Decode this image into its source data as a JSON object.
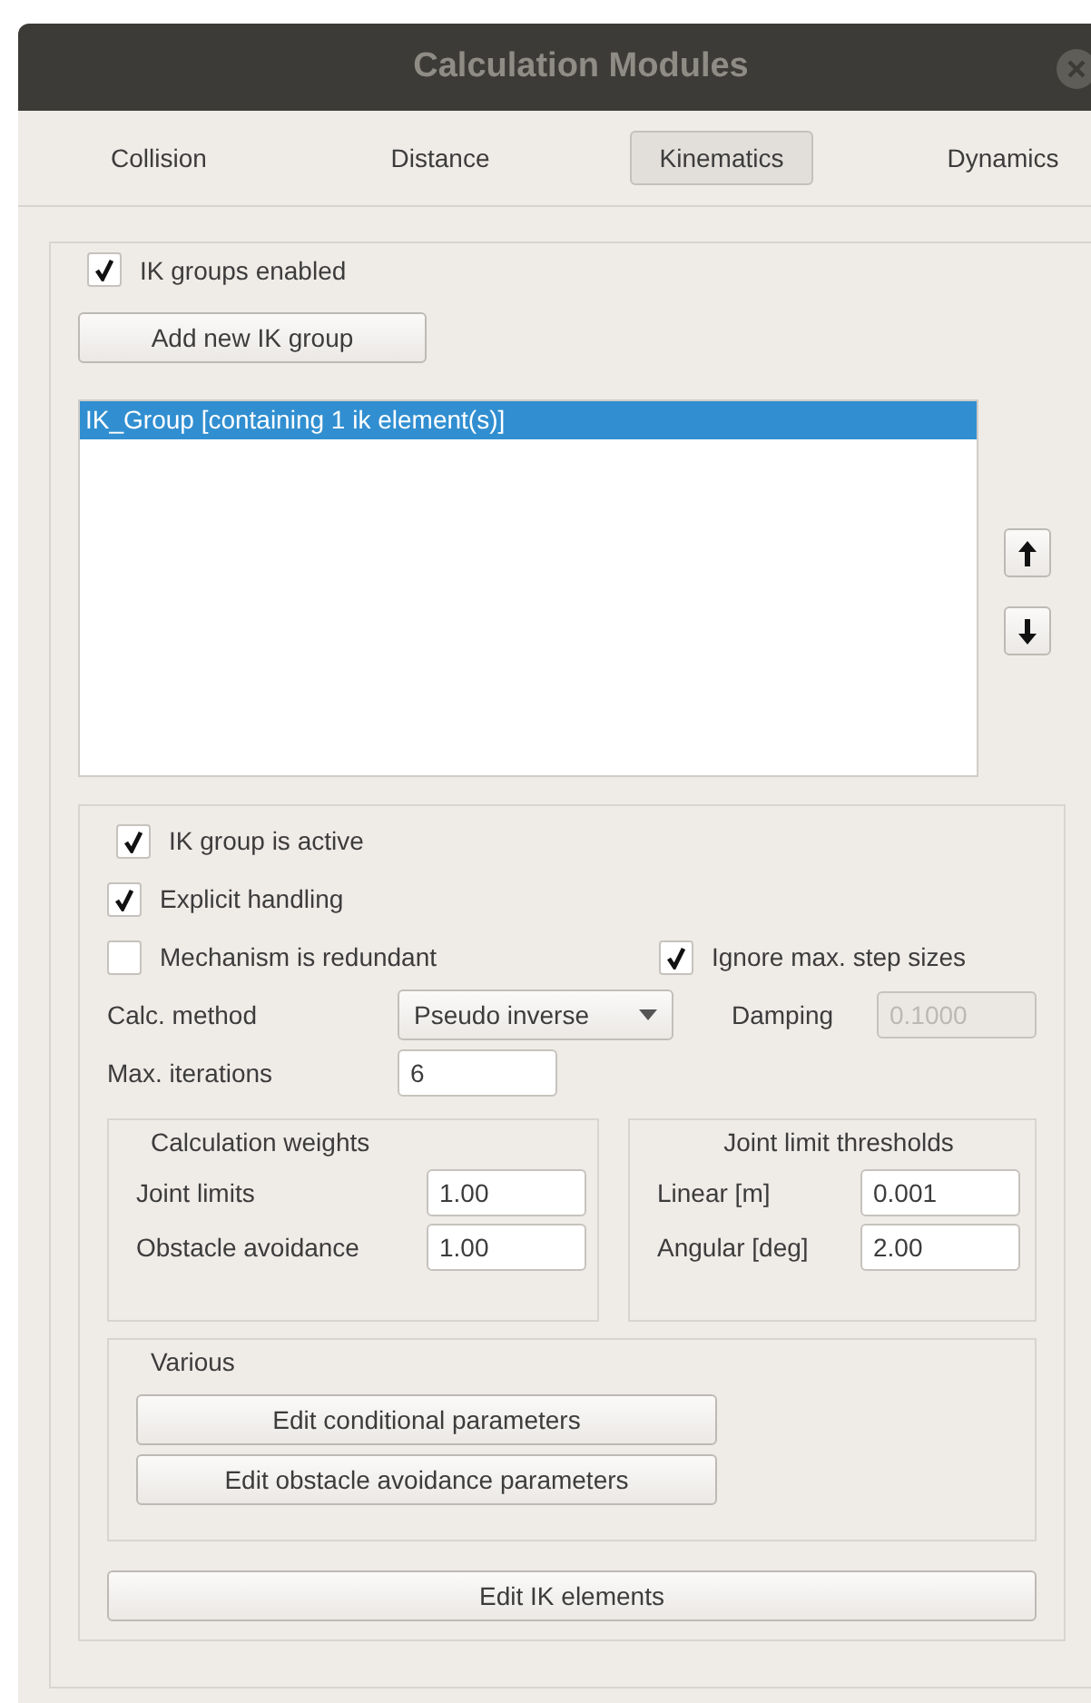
{
  "window": {
    "title": "Calculation Modules"
  },
  "tabs": [
    {
      "label": "Collision",
      "selected": false
    },
    {
      "label": "Distance",
      "selected": false
    },
    {
      "label": "Kinematics",
      "selected": true
    },
    {
      "label": "Dynamics",
      "selected": false
    }
  ],
  "groups_enabled": {
    "label": "IK groups enabled",
    "checked": true
  },
  "add_button": "Add new IK group",
  "group_list": [
    {
      "label": "IK_Group [containing 1 ik element(s)]",
      "selected": true
    }
  ],
  "group_settings": {
    "active": {
      "label": "IK group is active",
      "checked": true
    },
    "explicit_handling": {
      "label": "Explicit handling",
      "checked": true
    },
    "redundant": {
      "label": "Mechanism is redundant",
      "checked": false
    },
    "ignore_step_sizes": {
      "label": "Ignore max. step sizes",
      "checked": true
    },
    "calc_method": {
      "label": "Calc. method",
      "value": "Pseudo inverse"
    },
    "damping": {
      "label": "Damping",
      "value": "0.1000",
      "disabled": true
    },
    "max_iterations": {
      "label": "Max. iterations",
      "value": "6"
    }
  },
  "weights": {
    "title": "Calculation weights",
    "rows": [
      {
        "label": "Joint limits",
        "value": "1.00"
      },
      {
        "label": "Obstacle avoidance",
        "value": "1.00"
      }
    ]
  },
  "thresholds": {
    "title": "Joint limit thresholds",
    "rows": [
      {
        "label": "Linear [m]",
        "value": "0.001"
      },
      {
        "label": "Angular [deg]",
        "value": "2.00"
      }
    ]
  },
  "various": {
    "title": "Various",
    "buttons": [
      "Edit conditional parameters",
      "Edit obstacle avoidance parameters"
    ]
  },
  "edit_elements_button": "Edit IK elements"
}
